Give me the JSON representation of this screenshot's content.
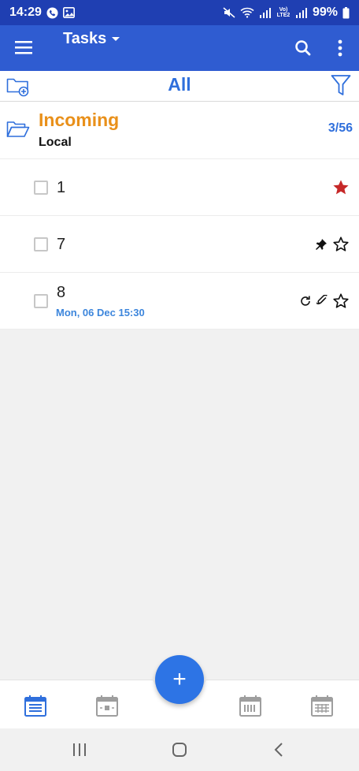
{
  "status_bar": {
    "time": "14:29",
    "battery": "99%",
    "network_label": "Vo) LTE2"
  },
  "app_bar": {
    "title": "Tasks",
    "icons": [
      "menu-icon",
      "dropdown-arrow-icon",
      "search-icon",
      "more-vert-icon"
    ]
  },
  "filter_bar": {
    "title": "All",
    "icons": [
      "folder-add-icon",
      "filter-icon"
    ]
  },
  "group": {
    "name": "Incoming",
    "subtitle": "Local",
    "count": "3/56",
    "icon": "folder-open-icon"
  },
  "tasks": [
    {
      "title": "1",
      "date": "",
      "icons": [
        "star-filled-icon"
      ],
      "checked": false
    },
    {
      "title": "7",
      "date": "",
      "icons": [
        "pin-icon",
        "star-outline-icon"
      ],
      "checked": false
    },
    {
      "title": "8",
      "date": "Mon, 06 Dec 15:30",
      "icons": [
        "repeat-icon",
        "attachment-icon",
        "star-outline-icon"
      ],
      "checked": false
    }
  ],
  "bottom_nav": {
    "items": [
      "tasks-calendar-icon",
      "day-calendar-icon",
      "add-task-fab",
      "week-calendar-icon",
      "month-calendar-icon"
    ],
    "fab_label": "+"
  },
  "system_nav": {
    "items": [
      "recents-button",
      "home-button",
      "back-button"
    ]
  },
  "colors": {
    "status_bar": "#1f3fb2",
    "app_bar": "#2f5cd1",
    "accent_blue": "#2f6fdc",
    "group_orange": "#e9901a",
    "star_red": "#c62828",
    "date_blue": "#3d86dc",
    "fab": "#2d74e5"
  }
}
